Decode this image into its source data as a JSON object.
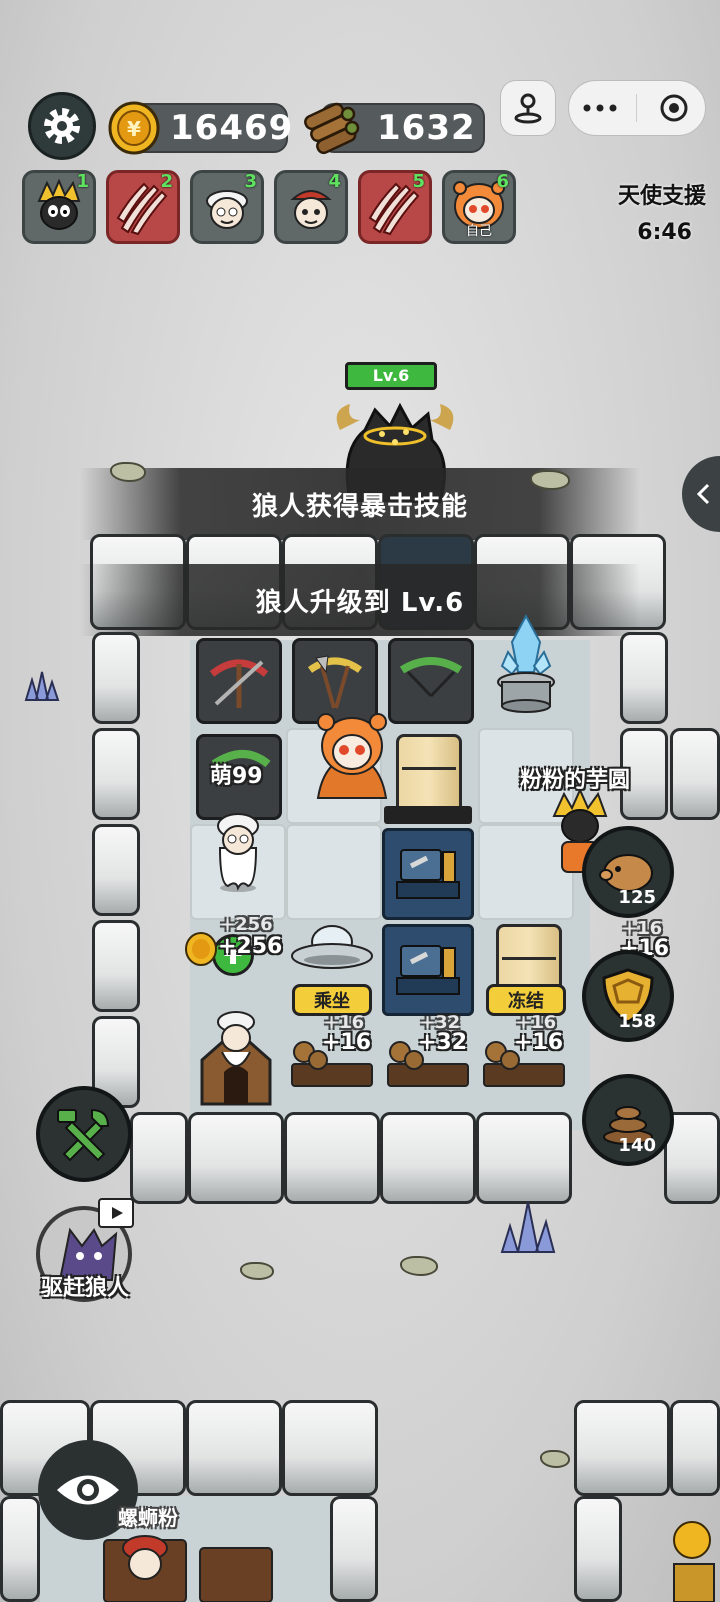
{
  "hud": {
    "coins": "16469",
    "wood": "1632",
    "icons": {
      "settings": "gear-icon",
      "coin": "coin-icon",
      "wood": "wood-logs-icon",
      "joystick": "joystick-icon",
      "more": "more-dots-icon",
      "close": "target-circle-icon"
    }
  },
  "players": [
    {
      "num": "1",
      "style": "normal",
      "label": ""
    },
    {
      "num": "2",
      "style": "red",
      "label": ""
    },
    {
      "num": "3",
      "style": "normal",
      "label": ""
    },
    {
      "num": "4",
      "style": "normal",
      "label": ""
    },
    {
      "num": "5",
      "style": "red",
      "label": ""
    },
    {
      "num": "6",
      "style": "normal",
      "label": "自己"
    }
  ],
  "angel": {
    "title": "天使支援",
    "time": "6:46"
  },
  "boss": {
    "level": "Lv.6"
  },
  "banners": {
    "first": "狼人获得暴击技能",
    "second": "狼人升级到 Lv.6"
  },
  "board": {
    "ally_name": "萌99",
    "other_name": "粉粉的芋圆",
    "coin_gain": "+256",
    "coin_gain_ghost": "+256",
    "ride_label": "乘坐",
    "freeze_label": "冻结",
    "wood_gains": [
      "+16",
      "+32",
      "+16"
    ],
    "wood_gains_ghost": [
      "+16",
      "+32",
      "+16"
    ],
    "right_gain": "+16",
    "right_gain_ghost": "+16"
  },
  "side_buttons": {
    "piggy_count": "125",
    "shield_count": "158",
    "poop_count": "140"
  },
  "actions": {
    "chase_label": "驱赶狼人",
    "lower_name": "螺蛳粉"
  },
  "colors": {
    "accent_green": "#3fb83f",
    "button_yellow": "#f3cd3a",
    "alert_red": "#b84848"
  }
}
